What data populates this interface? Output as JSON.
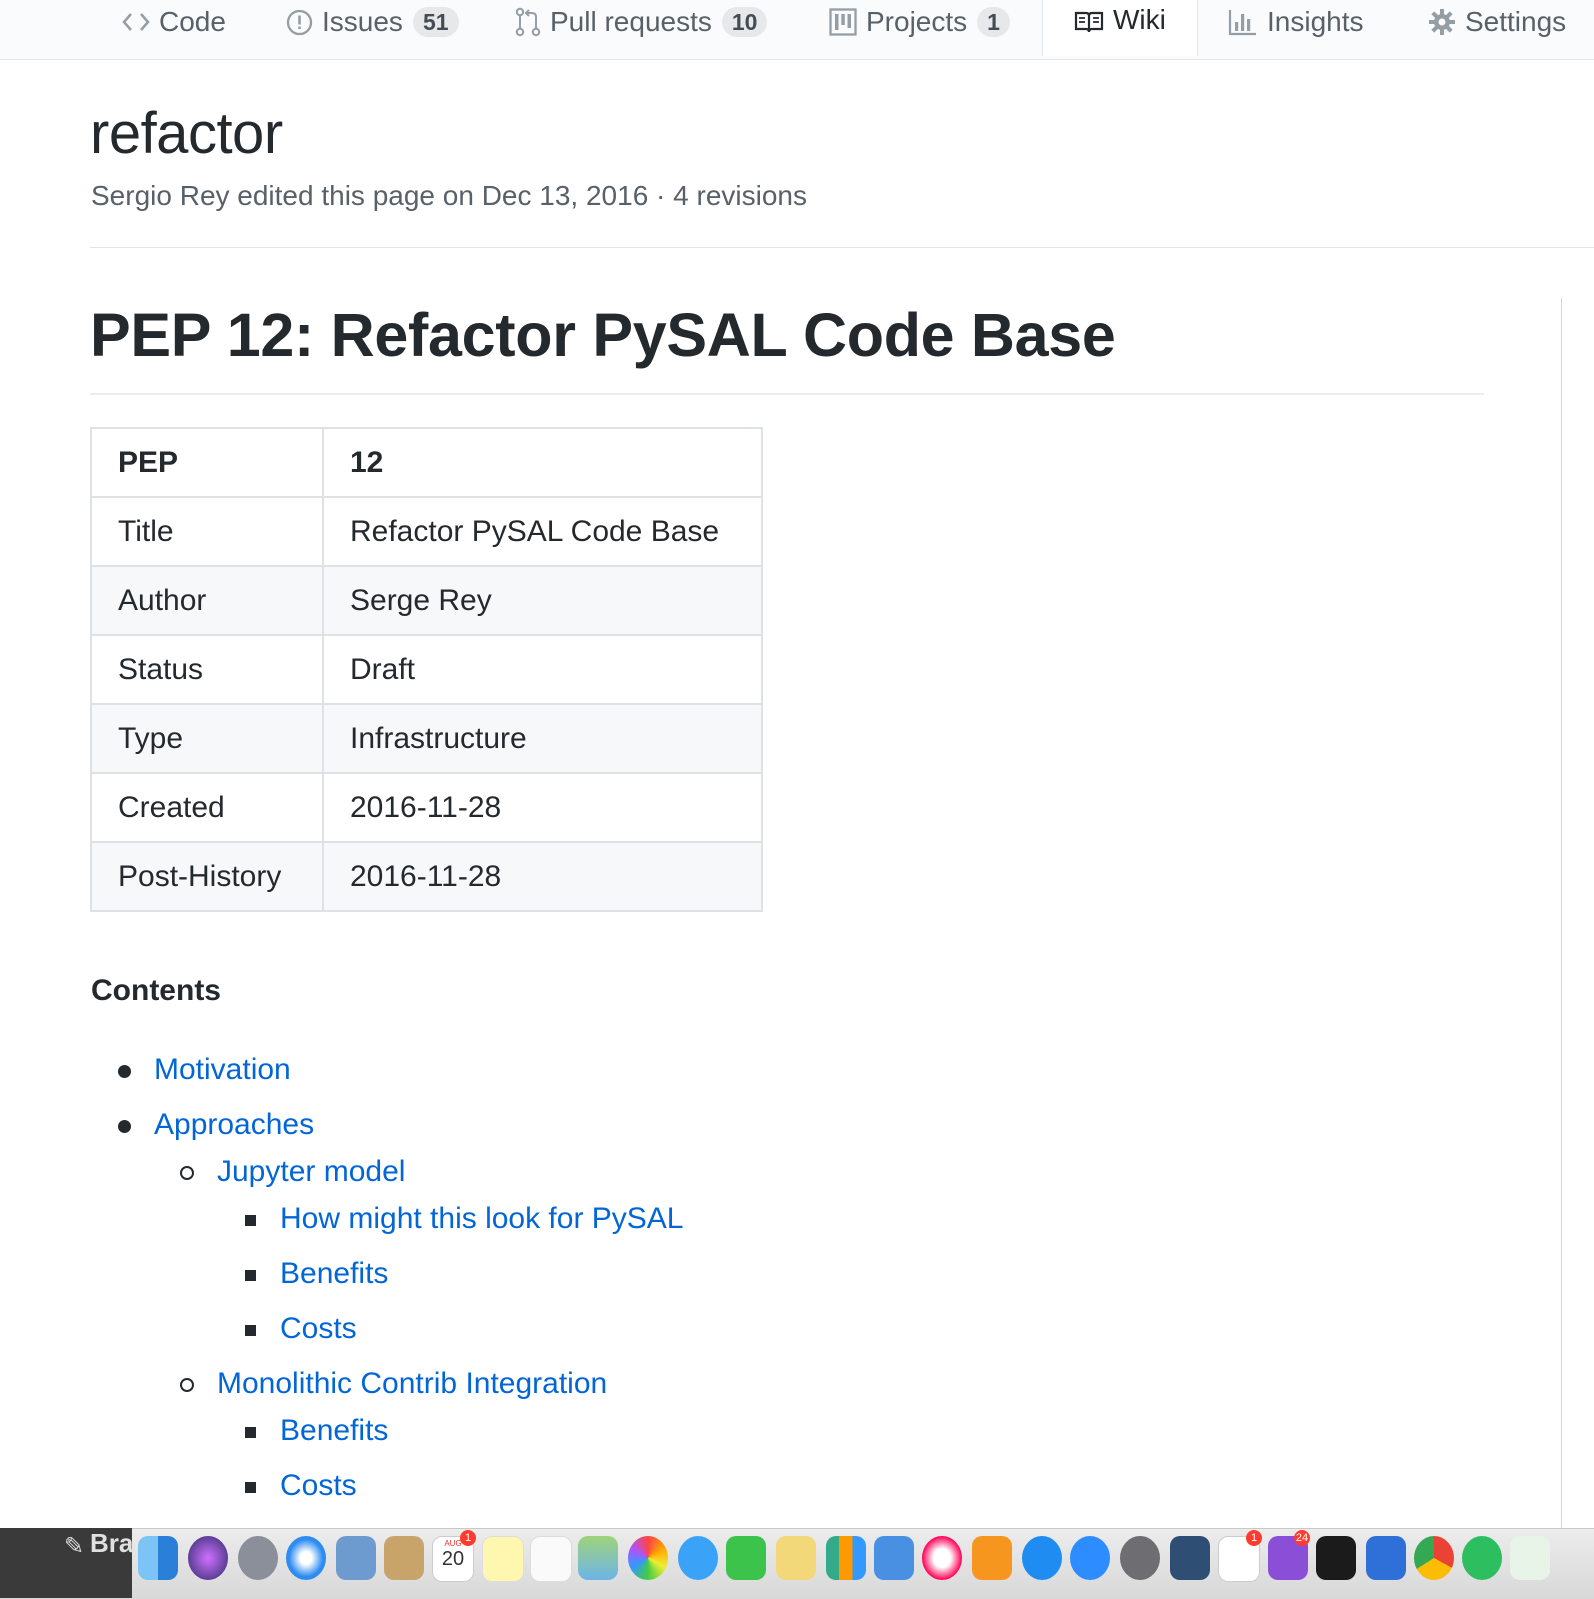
{
  "tabs": [
    {
      "label": "Code",
      "icon": "code-icon"
    },
    {
      "label": "Issues",
      "icon": "issue-icon",
      "count": "51"
    },
    {
      "label": "Pull requests",
      "icon": "pull-request-icon",
      "count": "10"
    },
    {
      "label": "Projects",
      "icon": "project-icon",
      "count": "1"
    },
    {
      "label": "Wiki",
      "icon": "book-icon",
      "selected": true
    },
    {
      "label": "Insights",
      "icon": "graph-icon"
    },
    {
      "label": "Settings",
      "icon": "gear-icon"
    }
  ],
  "page": {
    "title": "refactor",
    "meta": "Sergio Rey edited this page on Dec 13, 2016 · 4 revisions"
  },
  "wiki": {
    "heading": "PEP 12: Refactor PySAL Code Base",
    "table": {
      "header": {
        "key": "PEP",
        "value": "12"
      },
      "rows": [
        {
          "key": "Title",
          "value": "Refactor PySAL Code Base"
        },
        {
          "key": "Author",
          "value": "Serge Rey"
        },
        {
          "key": "Status",
          "value": "Draft"
        },
        {
          "key": "Type",
          "value": "Infrastructure"
        },
        {
          "key": "Created",
          "value": "2016-11-28"
        },
        {
          "key": "Post-History",
          "value": "2016-11-28"
        }
      ]
    },
    "contents_label": "Contents",
    "toc": [
      {
        "label": "Motivation",
        "level": 1
      },
      {
        "label": "Approaches",
        "level": 1
      },
      {
        "label": "Jupyter model",
        "level": 2
      },
      {
        "label": "How might this look for PySAL",
        "level": 3
      },
      {
        "label": "Benefits",
        "level": 3
      },
      {
        "label": "Costs",
        "level": 3
      },
      {
        "label": "Monolithic Contrib Integration",
        "level": 2
      },
      {
        "label": "Benefits",
        "level": 3
      },
      {
        "label": "Costs",
        "level": 3
      }
    ]
  },
  "dock": {
    "left_text": "Bra",
    "calendar_day": "20",
    "calendar_month": "AUG",
    "badges": [
      "1",
      "1",
      "24"
    ]
  },
  "colors": {
    "link": "#0366d6",
    "text": "#24292e",
    "muted": "#586069",
    "selected_tab_accent": "#e36209"
  }
}
